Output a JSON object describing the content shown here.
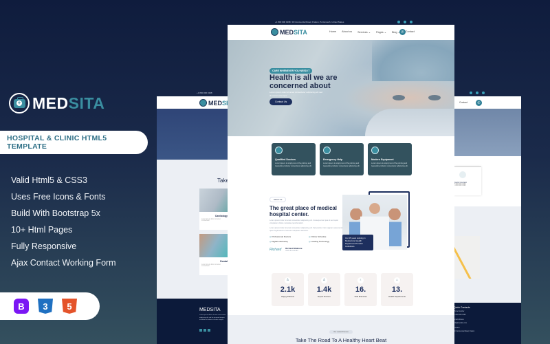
{
  "brand": {
    "name_part1": "MED",
    "name_part2": "SITA",
    "logo_icon": "medical-kit-icon"
  },
  "tagline": "HOSPITAL & CLINIC HTML5 TEMPLATE",
  "features": [
    "Valid Html5 & CSS3",
    "Uses Free Icons & Fonts",
    "Build With Bootstrap 5x",
    "10+ Html Pages",
    "Fully Responsive",
    "Ajax Contact Working Form"
  ],
  "tech_badges": [
    {
      "name": "bootstrap-icon",
      "glyph": "B",
      "color": "#7b16f4"
    },
    {
      "name": "css3-icon",
      "glyph": "3",
      "color": "#1f70c1"
    },
    {
      "name": "html5-icon",
      "glyph": "5",
      "color": "#e4532a"
    }
  ],
  "preview": {
    "topbar": {
      "phone": "+1 800 000 0198",
      "address": "30 Commercial Road, Fratton, Portsmouth, United States"
    },
    "nav": {
      "logo_part1": "MED",
      "logo_part2": "SITA",
      "items": [
        "Home",
        "About us",
        "Services ⌄",
        "Pages ⌄",
        "Blog ⌄",
        "Contact"
      ],
      "phone_icon": "phone-icon"
    },
    "hero": {
      "badge": "CARE WHENEVER YOU NEED IT",
      "title": "Health is all we are concerned about",
      "subtitle": "Lorem ipsum dolor sit amet consectetur adipiscing elit sed do eiusmod tempor",
      "button": "Contact Us"
    },
    "cards": [
      {
        "title": "Qualified Doctors",
        "text": "Lorem Ipsum is simply text of the printing and typesetting industry consectetur adipiscing elit."
      },
      {
        "title": "Emergency Help",
        "text": "Lorem Ipsum is simply text of the printing and typesetting industry consectetur adipiscing elit."
      },
      {
        "title": "Modern Equipment",
        "text": "Lorem Ipsum is simply text of the printing and typesetting industry consectetur adipiscing elit."
      }
    ],
    "about": {
      "pill": "About Us",
      "title": "The great place of medical hospital center.",
      "para1": "Lorem ipsum dolor sit amet consectetur adipiscing elit. Consequuntur quia sit sed quod voluptatum dolore molestiae reprehenderit.",
      "para2": "Lorem ipsum dolor sit amet consectetur adipiscing elit. Sed pariatur nisi magnam assumenda quam fugit laborum nesciunt voluptates distinctio.",
      "checks": [
        "Professional Doctors",
        "Online Schedule",
        "Digital Laboratory",
        "Leading Technology"
      ],
      "signature": "Richard",
      "person_name": "Richard Muldone",
      "person_role": "CEO & Founder",
      "note": "Our 25 years working in Medical And Health Department Provider Institutions."
    },
    "stats": [
      {
        "value": "2.1k",
        "label": "Happy Patients",
        "icon": "patient-icon"
      },
      {
        "value": "1.4k",
        "label": "Expert Doctors",
        "icon": "doctor-icon"
      },
      {
        "value": "16.",
        "label": "Total Branches",
        "icon": "stethoscope-icon"
      },
      {
        "value": "13.",
        "label": "Health Departments",
        "icon": "hospital-icon"
      }
    ],
    "heart": {
      "pill": "Our Latest Process",
      "title": "Take The Road To A Healthy Heart Beat"
    },
    "left_screen": {
      "section_title": "Take",
      "cards": [
        {
          "title": "Cardiology"
        },
        {
          "title": "Dental"
        }
      ],
      "footer_logo": "MEDSITA",
      "footer_text": "Lorem ipsum dolor sit amet consectetur adipiscing elit sed do eiusmod tempor incididunt ut labore et dolore magna."
    },
    "right_screen": {
      "nav_item": "Contact",
      "contact_title": "Quick Contact",
      "contact_line1": "+1 800 000 0198",
      "contact_line2": "+1 800 000 0199",
      "footer_title": "Quick Contacts",
      "footer_labels": [
        "Phone Number",
        "+1 800 000 0198",
        "Email Address",
        "info@medsita.com",
        "Location",
        "30 Commercial Road, Fratton"
      ]
    }
  }
}
